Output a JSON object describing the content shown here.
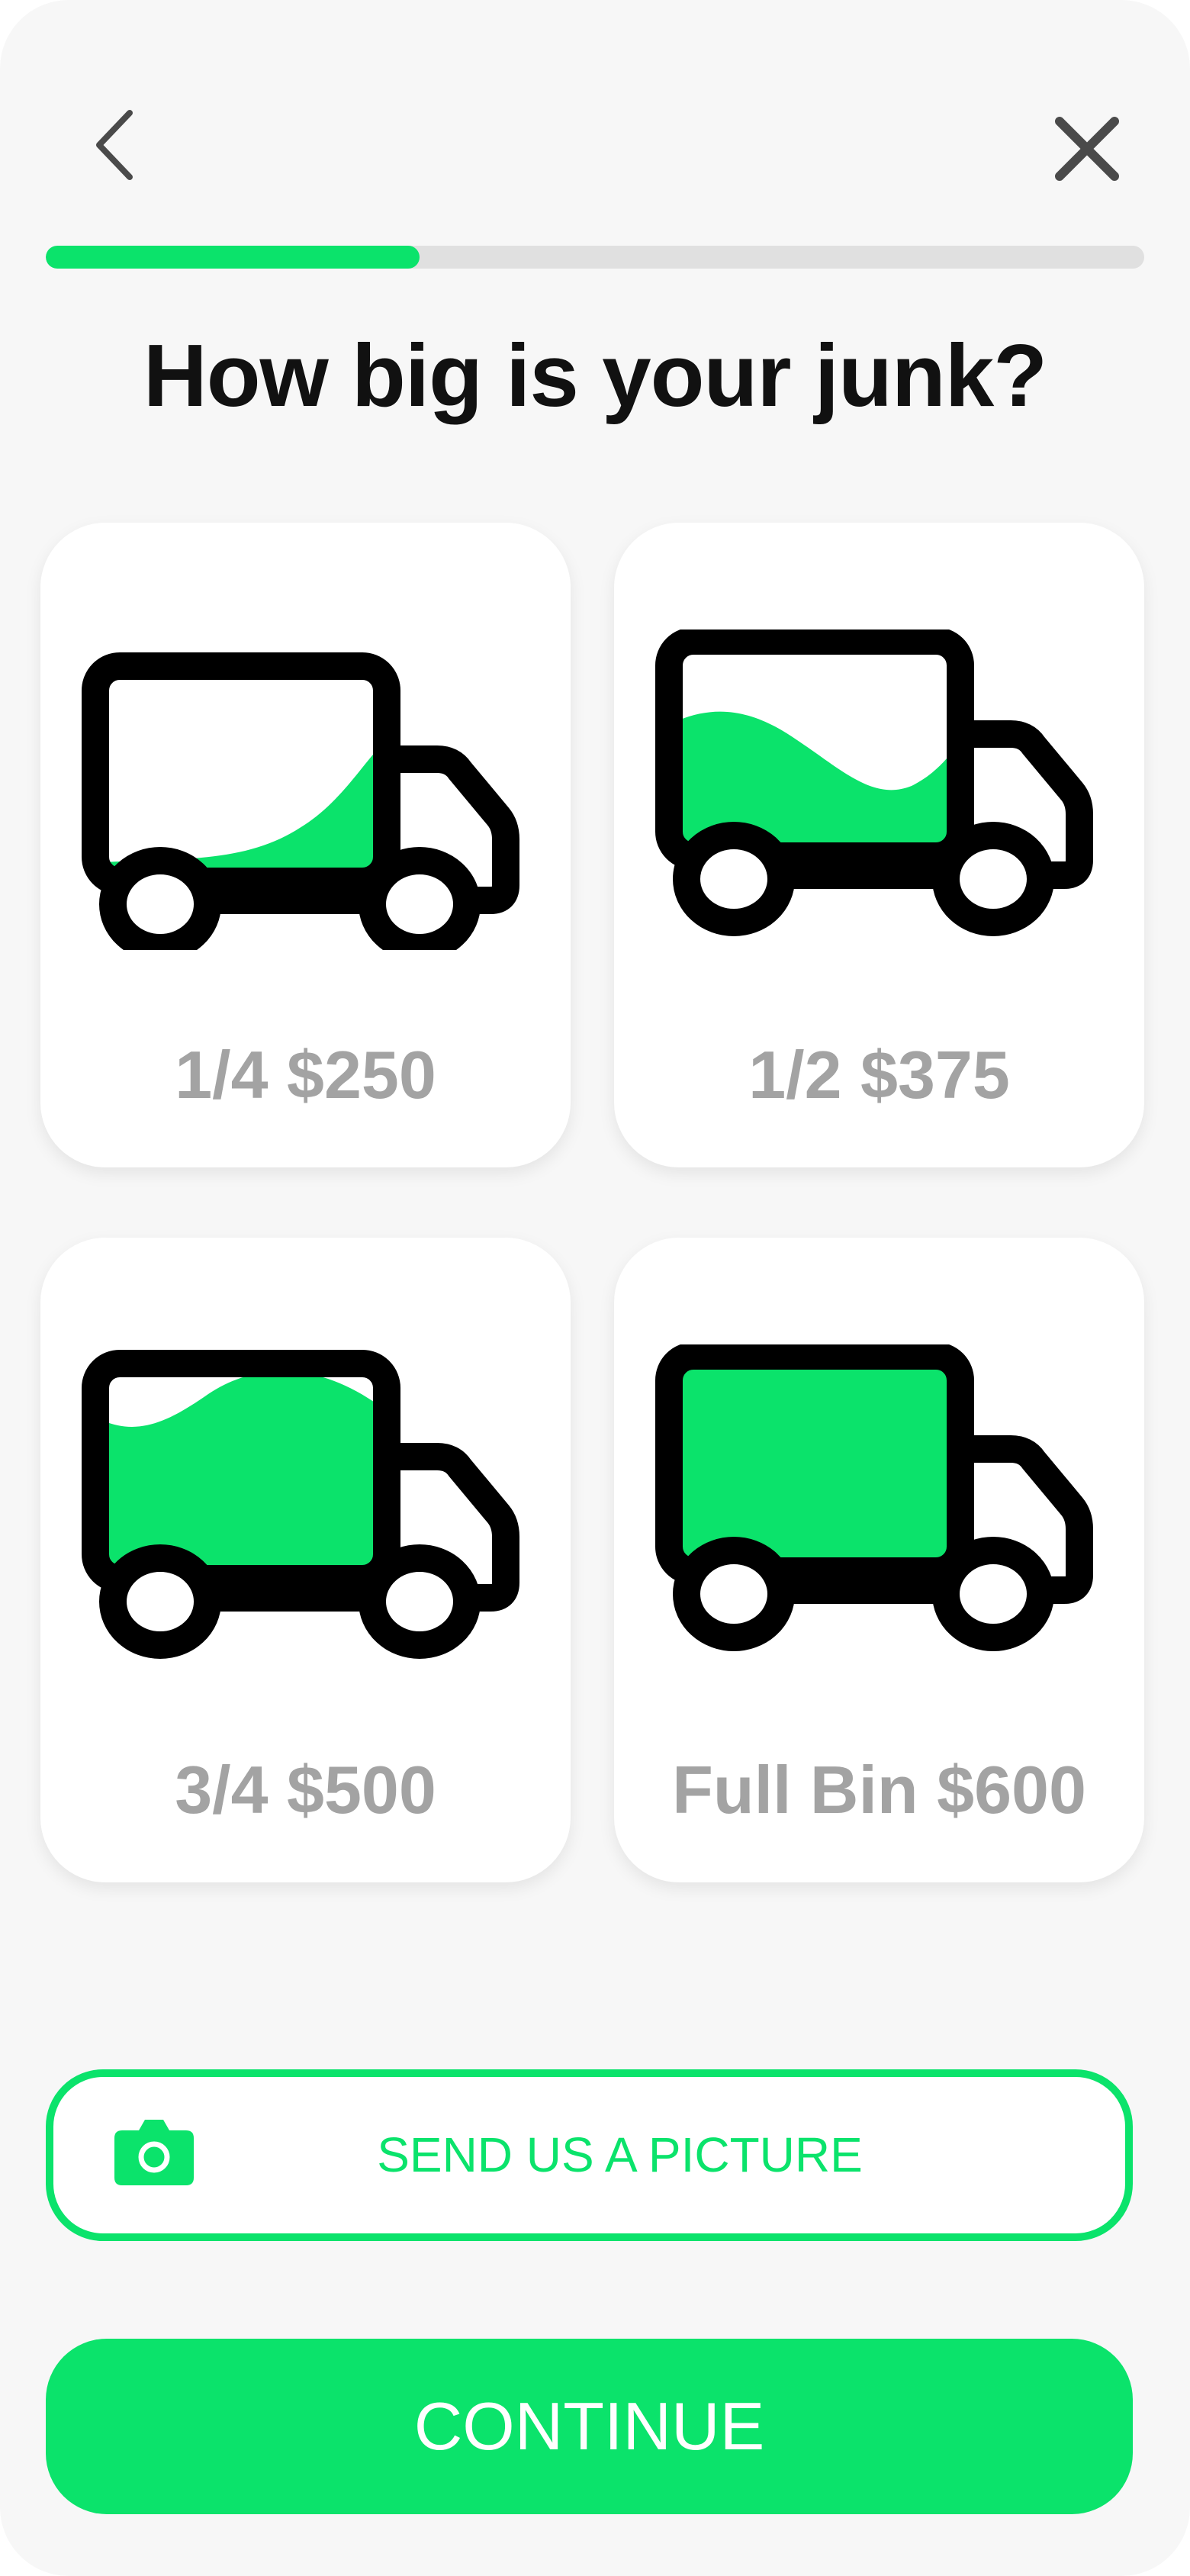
{
  "header": {
    "back_icon": "chevron-left-icon",
    "close_icon": "close-icon"
  },
  "progress": {
    "fraction": 0.34,
    "fill_color": "#0be36b",
    "track_color": "#e0e0e0"
  },
  "title": "How big is your junk?",
  "options": [
    {
      "label": "1/4 $250",
      "fill_level": 0.25,
      "icon": "truck-quarter-icon"
    },
    {
      "label": "1/2 $375",
      "fill_level": 0.5,
      "icon": "truck-half-icon"
    },
    {
      "label": "3/4 $500",
      "fill_level": 0.75,
      "icon": "truck-three-quarter-icon"
    },
    {
      "label": "Full Bin $600",
      "fill_level": 1.0,
      "icon": "truck-full-icon"
    }
  ],
  "picture_button": {
    "label": "SEND US A PICTURE",
    "icon": "camera-icon"
  },
  "continue_button": {
    "label": "CONTINUE"
  },
  "colors": {
    "accent": "#0be36b",
    "background": "#f7f7f7",
    "card": "#ffffff",
    "label_gray": "#a3a3a3",
    "title": "#111111"
  }
}
